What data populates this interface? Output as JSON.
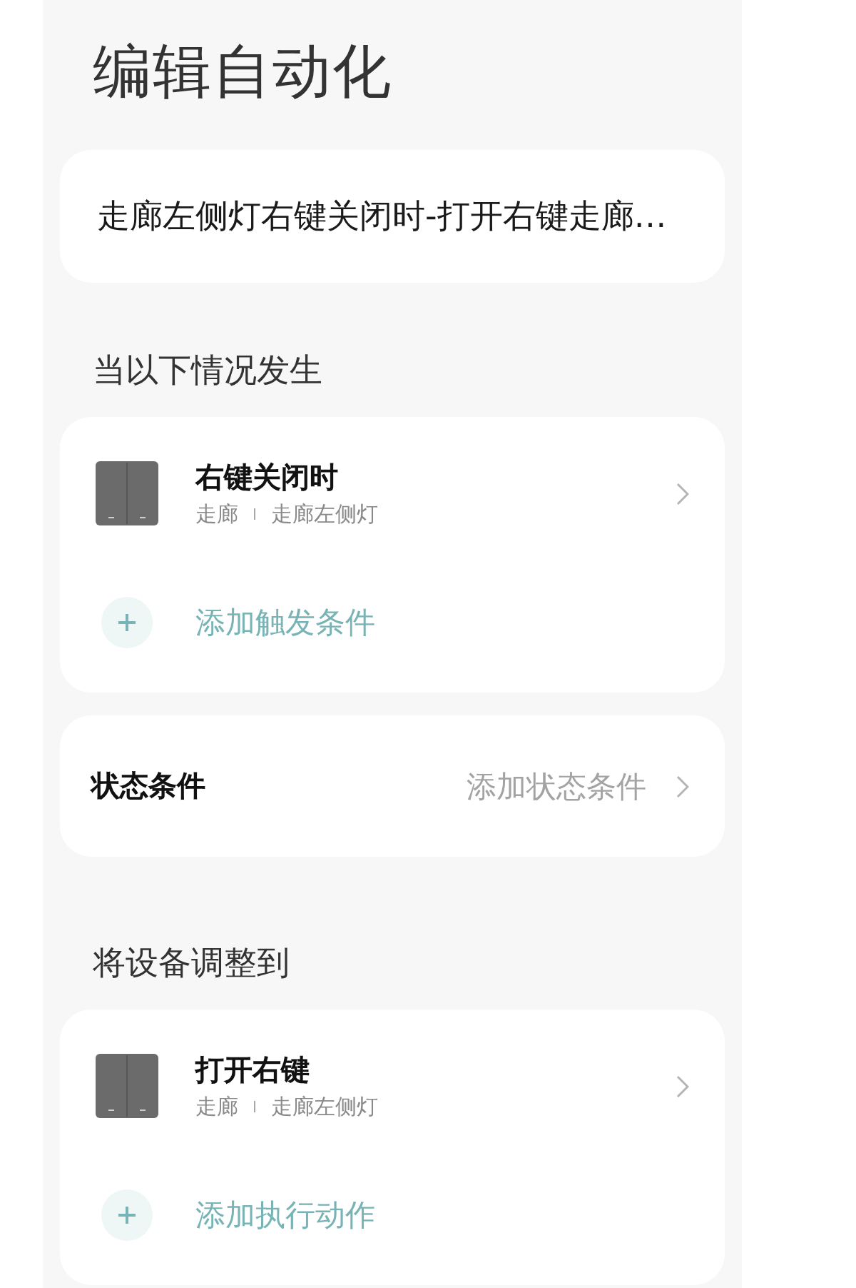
{
  "title": "编辑自动化",
  "name_field": {
    "value": "走廊左侧灯右键关闭时-打开右键走廊…"
  },
  "triggers": {
    "heading": "当以下情况发生",
    "items": [
      {
        "name": "右键关闭时",
        "room": "走廊",
        "device": "走廊左侧灯"
      }
    ],
    "add_label": "添加触发条件"
  },
  "conditions": {
    "label": "状态条件",
    "add_label": "添加状态条件"
  },
  "actions": {
    "heading": "将设备调整到",
    "items": [
      {
        "name": "打开右键",
        "room": "走廊",
        "device": "走廊左侧灯"
      }
    ],
    "add_label": "添加执行动作"
  }
}
